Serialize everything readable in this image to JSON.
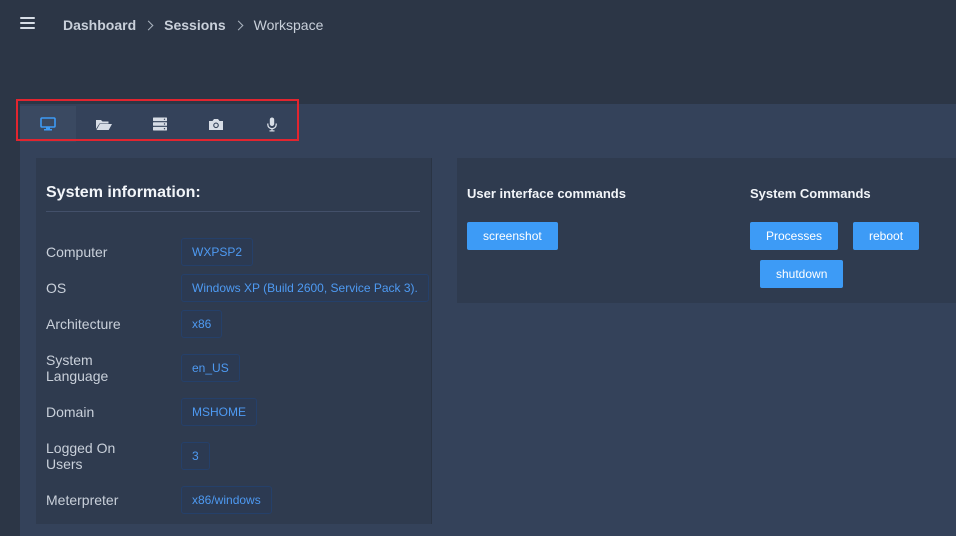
{
  "breadcrumb": [
    "Dashboard",
    "Sessions",
    "Workspace"
  ],
  "tabs": [
    {
      "icon": "monitor-icon",
      "active": true
    },
    {
      "icon": "folder-open-icon",
      "active": false
    },
    {
      "icon": "server-icon",
      "active": false
    },
    {
      "icon": "camera-icon",
      "active": false
    },
    {
      "icon": "microphone-icon",
      "active": false
    }
  ],
  "system_info": {
    "title": "System information:",
    "rows": [
      {
        "label": "Computer",
        "value": "WXPSP2"
      },
      {
        "label": "OS",
        "value": "Windows XP (Build 2600, Service Pack 3)."
      },
      {
        "label": "Architecture",
        "value": "x86"
      },
      {
        "label": "System Language",
        "value": "en_US"
      },
      {
        "label": "Domain",
        "value": "MSHOME"
      },
      {
        "label": "Logged On Users",
        "value": "3"
      },
      {
        "label": "Meterpreter",
        "value": "x86/windows"
      }
    ]
  },
  "ui_commands": {
    "title": "User interface commands",
    "buttons": [
      "screenshot"
    ]
  },
  "system_commands": {
    "title": "System Commands",
    "buttons": [
      "Processes",
      "reboot",
      "shutdown"
    ]
  },
  "colors": {
    "accent": "#3d9bf6",
    "highlight_border": "#e2252f",
    "value_text": "#4e9af2"
  }
}
